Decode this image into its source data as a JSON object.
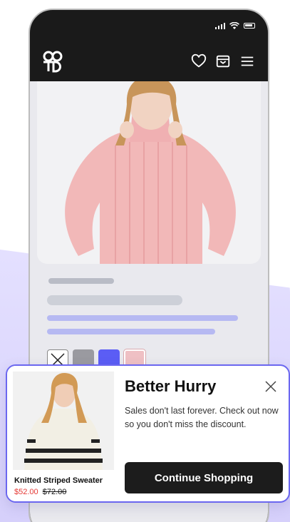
{
  "colors": {
    "accent": "#6b67f0",
    "sale_price": "#e53935",
    "dark": "#1c1c1c",
    "swatch_grey": "#9a9aa0",
    "swatch_blue": "#5b5df5",
    "swatch_pink": "#efc0c4"
  },
  "status_bar": {
    "icons": [
      "signal-icon",
      "wifi-icon",
      "battery-icon"
    ]
  },
  "header": {
    "logo": "brand-logo",
    "icons": [
      "heart-icon",
      "archive-box-icon",
      "menu-icon"
    ]
  },
  "product_page": {
    "swatches": [
      "none",
      "grey",
      "blue",
      "pink"
    ]
  },
  "popup": {
    "title": "Better Hurry",
    "message": "Sales don't last forever. Check out now so you don't miss the discount.",
    "cta_label": "Continue Shopping",
    "product": {
      "name": "Knitted Striped Sweater",
      "sale_price": "$52.00",
      "original_price": "$72.00"
    }
  }
}
